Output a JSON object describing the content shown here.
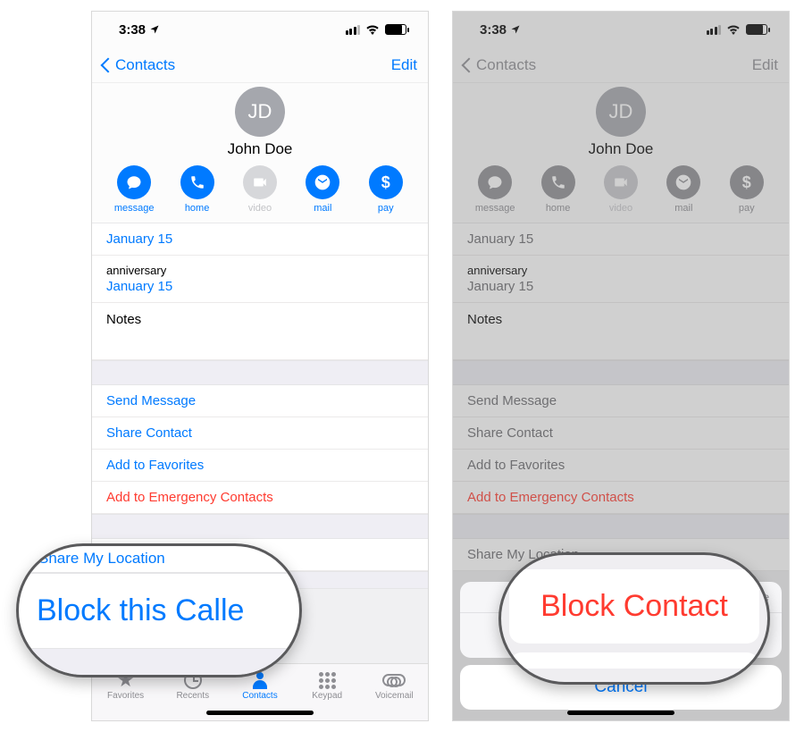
{
  "status": {
    "time": "3:38",
    "loc_icon": "location"
  },
  "nav": {
    "back": "Contacts",
    "edit": "Edit"
  },
  "contact": {
    "initials": "JD",
    "name": "John  Doe"
  },
  "actions": {
    "message": "message",
    "home": "home",
    "video": "video",
    "mail": "mail",
    "pay": "pay"
  },
  "info": {
    "date_top": "January 15",
    "anniv_label": "anniversary",
    "anniv_date": "January 15",
    "notes": "Notes"
  },
  "links": {
    "send": "Send Message",
    "share": "Share Contact",
    "fav": "Add to Favorites",
    "emerg": "Add to Emergency Contacts",
    "shareloc": "Share My Location"
  },
  "tabs": {
    "fav": "Favorites",
    "rec": "Recents",
    "con": "Contacts",
    "key": "Keypad",
    "vm": "Voicemail"
  },
  "sheet": {
    "hint_tail": "Time",
    "block": "Block Contact",
    "cancel": "Cancel"
  },
  "mag": {
    "left_above": "Share My Location",
    "left_big": "Block this Calle",
    "right_big": "Block Contact"
  }
}
